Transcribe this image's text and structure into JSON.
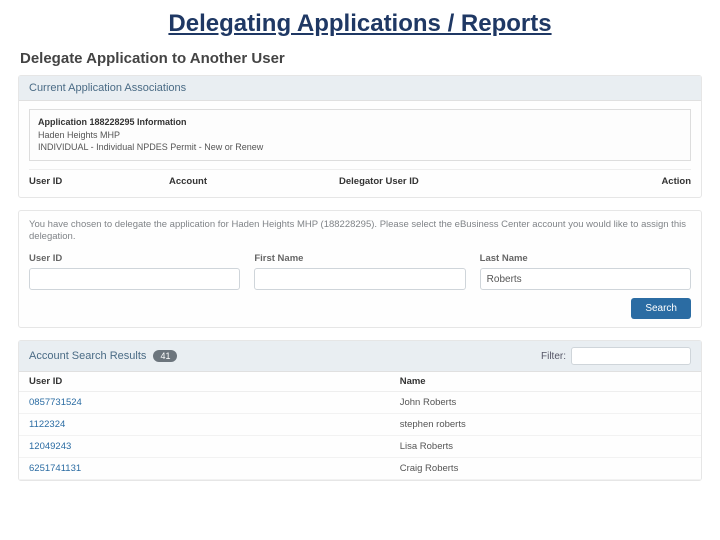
{
  "slide_title": "Delegating Applications / Reports",
  "page_heading": "Delegate Application to Another User",
  "assoc": {
    "header": "Current Application Associations",
    "info_title": "Application 188228295 Information",
    "info_line1": "Haden Heights MHP",
    "info_line2": "INDIVIDUAL - Individual NPDES Permit - New or Renew",
    "cols": {
      "user": "User ID",
      "account": "Account",
      "delegator": "Delegator User ID",
      "action": "Action"
    }
  },
  "search": {
    "instruction": "You have chosen to delegate the application for Haden Heights MHP (188228295). Please select the eBusiness Center account you would like to assign this delegation.",
    "labels": {
      "user": "User ID",
      "first": "First Name",
      "last": "Last Name"
    },
    "values": {
      "user": "",
      "first": "",
      "last": "Roberts"
    },
    "button": "Search"
  },
  "results": {
    "header": "Account Search Results",
    "count": "41",
    "filter_label": "Filter:",
    "filter_value": "",
    "cols": {
      "id": "User ID",
      "name": "Name"
    },
    "rows": [
      {
        "id": "0857731524",
        "name": "John Roberts"
      },
      {
        "id": "1122324",
        "name": "stephen roberts"
      },
      {
        "id": "12049243",
        "name": "Lisa Roberts"
      },
      {
        "id": "6251741131",
        "name": "Craig Roberts"
      }
    ]
  }
}
